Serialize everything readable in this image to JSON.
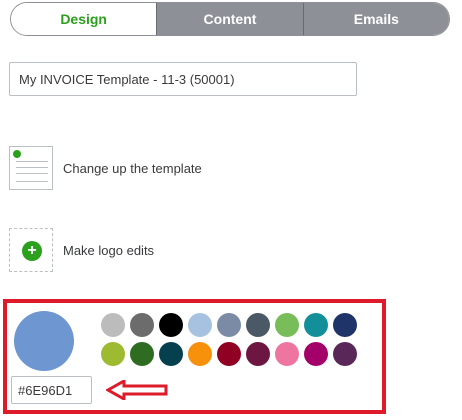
{
  "tabs": [
    {
      "label": "Design",
      "active": true
    },
    {
      "label": "Content",
      "active": false
    },
    {
      "label": "Emails",
      "active": false
    }
  ],
  "template_name": {
    "value": "My INVOICE Template - 11-3 (50001)"
  },
  "options": {
    "template": {
      "label": "Change up the template",
      "icon": "template-thumbnail-icon"
    },
    "logo": {
      "label": "Make logo edits",
      "icon": "add-logo-icon"
    }
  },
  "color_picker": {
    "selected_hex": "#6E96D1",
    "selected_color": "#6e96d1",
    "palette": [
      "#bcbcbc",
      "#6c6c6c",
      "#000000",
      "#a7c2e0",
      "#7b8ba5",
      "#4b5966",
      "#79bd5b",
      "#138f9a",
      "#1f3468",
      "#9dba31",
      "#2e6c21",
      "#06404f",
      "#f7900a",
      "#8f0022",
      "#6d1641",
      "#ef75a1",
      "#a3006a",
      "#5a2858"
    ]
  },
  "colors": {
    "accent": "#2ca01c",
    "highlight": "#dd1b2a"
  }
}
